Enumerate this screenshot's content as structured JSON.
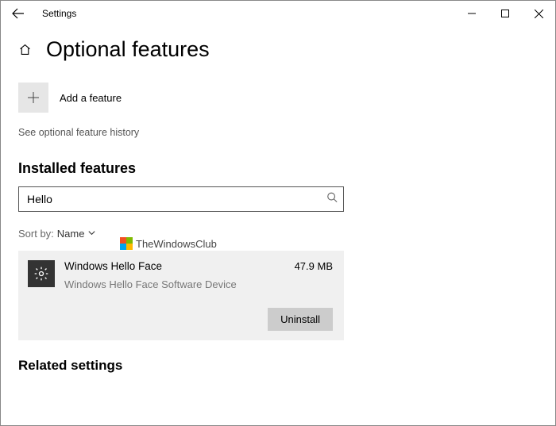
{
  "window": {
    "title": "Settings"
  },
  "page": {
    "heading": "Optional features",
    "add_feature_label": "Add a feature",
    "history_link": "See optional feature history",
    "installed_heading": "Installed features",
    "related_heading": "Related settings"
  },
  "search": {
    "value": "Hello"
  },
  "sort": {
    "label": "Sort by:",
    "value": "Name"
  },
  "feature": {
    "name": "Windows Hello Face",
    "description": "Windows Hello Face Software Device",
    "size": "47.9 MB",
    "uninstall_label": "Uninstall"
  },
  "watermark": {
    "text": "TheWindowsClub"
  }
}
